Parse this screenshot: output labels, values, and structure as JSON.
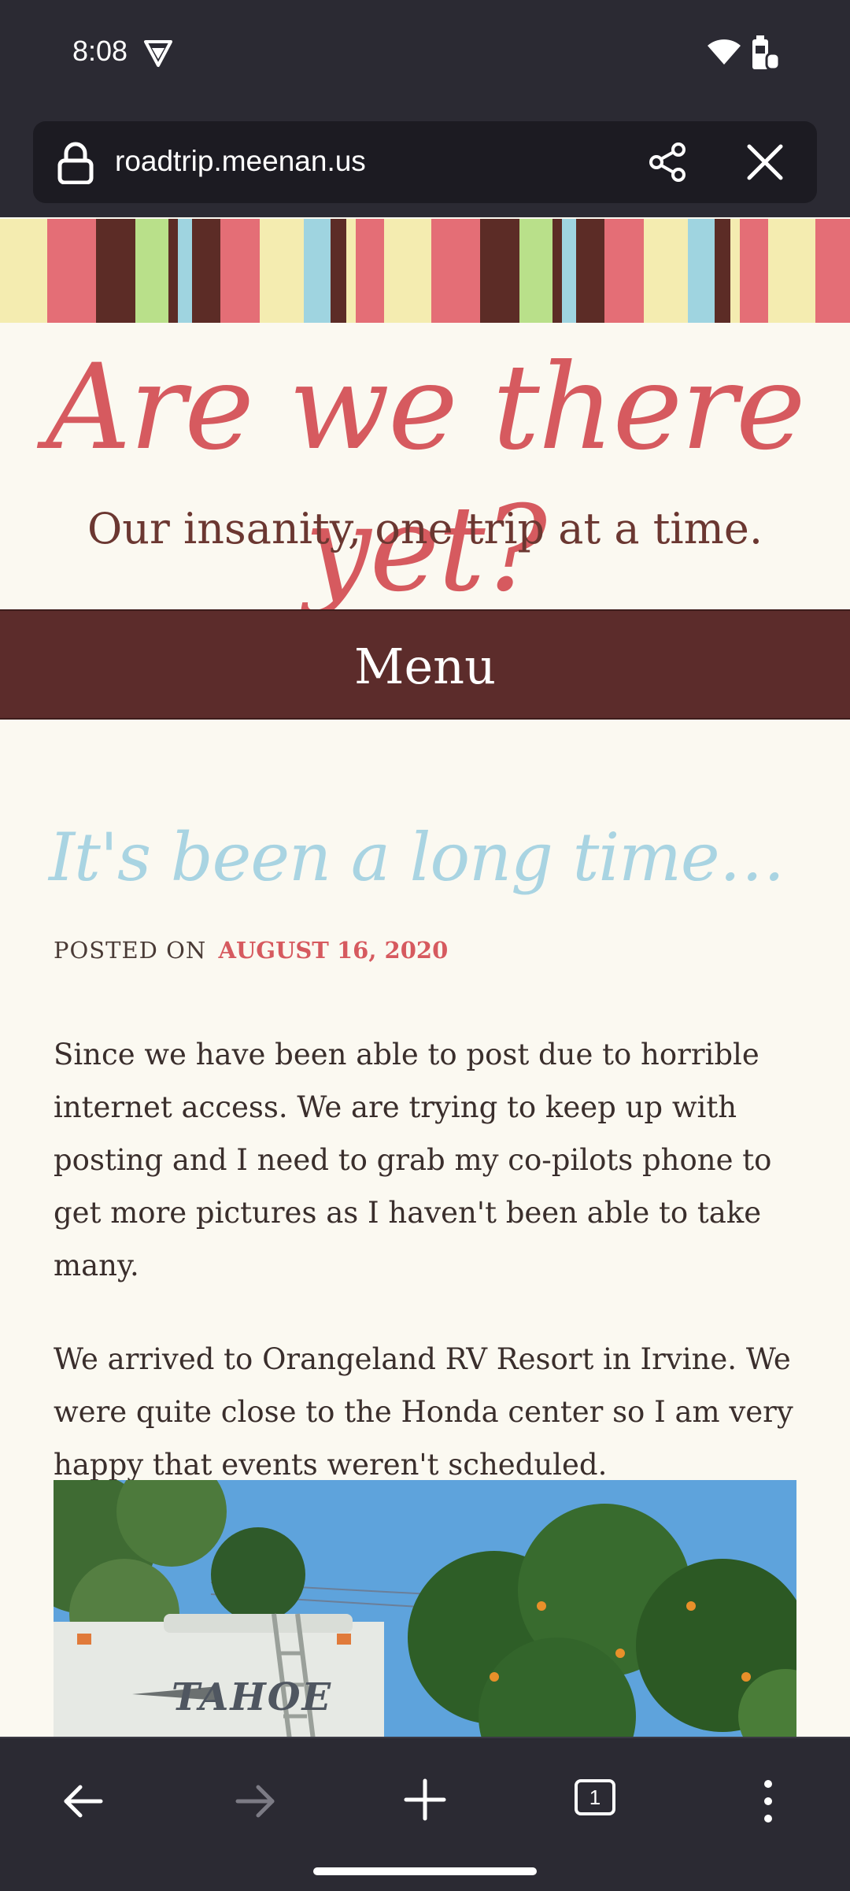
{
  "status_bar": {
    "time": "8:08"
  },
  "url_bar": {
    "url": "roadtrip.meenan.us"
  },
  "site": {
    "title": "Are we there yet?",
    "tagline": "Our insanity, one trip at a time.",
    "menu_label": "Menu"
  },
  "post": {
    "title": "It's been a long time…",
    "posted_on_label": "POSTED ON",
    "date": "AUGUST 16, 2020",
    "paragraphs": [
      "Since we have been able to post due to horrible internet access. We are trying to keep up with posting and I need to grab my co-pilots phone to get more pictures as I haven't been able to take many.",
      "We arrived to Orangeland RV Resort in Irvine. We were quite close to the Honda center so I am very happy that events weren't scheduled."
    ],
    "image_text": "TAHOE"
  },
  "toolbar": {
    "tab_count": "1"
  },
  "colors": {
    "title": "#d65a5f",
    "menu_bg": "#5c2c2b",
    "post_title": "#a9d4e2",
    "chrome_bg": "#2b2a33"
  },
  "icons": [
    "vpn-icon",
    "wifi-icon",
    "battery-icon",
    "lock-icon",
    "share-icon",
    "close-icon",
    "back-icon",
    "forward-icon",
    "new-tab-icon",
    "menu-dots-icon"
  ]
}
